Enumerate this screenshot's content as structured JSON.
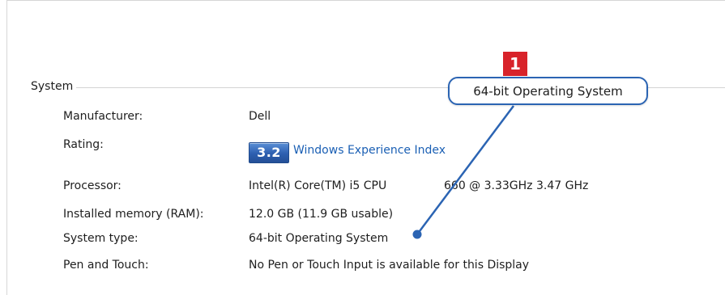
{
  "section": {
    "title": "System"
  },
  "rows": {
    "manufacturer": {
      "label": "Manufacturer:",
      "value": "Dell"
    },
    "rating": {
      "label": "Rating:",
      "score": "3.2",
      "link": "Windows Experience Index"
    },
    "processor": {
      "label": "Processor:",
      "value": "Intel(R) Core(TM) i5 CPU",
      "freq": "660  @ 3.33GHz   3.47 GHz"
    },
    "memory": {
      "label": "Installed memory (RAM):",
      "value": "12.0 GB (11.9 GB usable)"
    },
    "system_type": {
      "label": "System type:",
      "value": "64-bit Operating System"
    },
    "pen_touch": {
      "label": "Pen and Touch:",
      "value": "No Pen or Touch Input is available for this Display"
    }
  },
  "callout": {
    "number": "1",
    "text": "64-bit Operating System"
  },
  "colors": {
    "accent": "#2b64b3",
    "badge_red": "#d8232a",
    "link": "#1a5fb4"
  }
}
